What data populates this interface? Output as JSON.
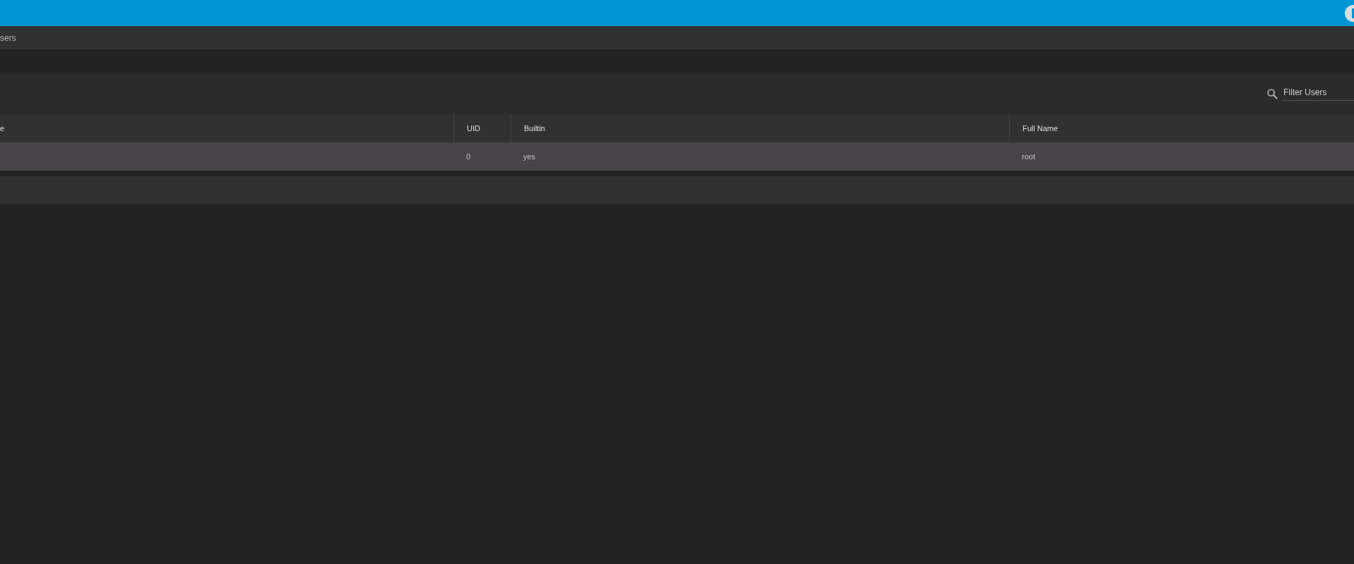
{
  "breadcrumb": {
    "label": "sers"
  },
  "filter": {
    "placeholder": "Filter Users"
  },
  "table": {
    "columns": [
      "e",
      "UID",
      "Builtin",
      "Full Name"
    ],
    "rows": [
      {
        "cells": [
          "",
          "0",
          "yes",
          "root"
        ],
        "selected": true
      }
    ]
  }
}
